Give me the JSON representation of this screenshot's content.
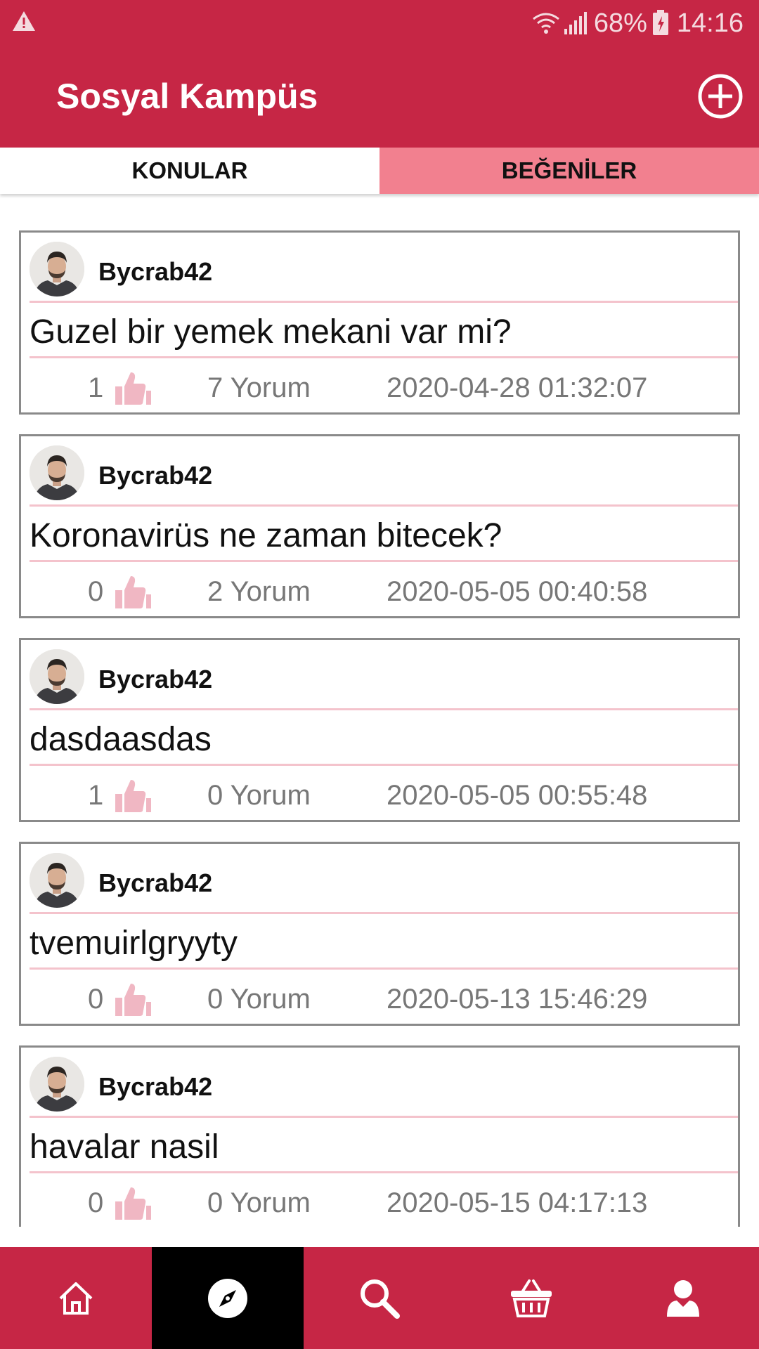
{
  "status_bar": {
    "battery": "68%",
    "time": "14:16"
  },
  "app": {
    "title": "Sosyal Kampüs"
  },
  "tabs": [
    {
      "label": "KONULAR"
    },
    {
      "label": "BEĞENİLER"
    }
  ],
  "posts": [
    {
      "username": "Bycrab42",
      "title": "Guzel bir yemek mekani var mi?",
      "likes": "1",
      "comments": "7 Yorum",
      "date": "2020-04-28 01:32:07"
    },
    {
      "username": "Bycrab42",
      "title": "Koronavirüs ne zaman bitecek?",
      "likes": "0",
      "comments": "2 Yorum",
      "date": "2020-05-05 00:40:58"
    },
    {
      "username": "Bycrab42",
      "title": "dasdaasdas",
      "likes": "1",
      "comments": "0 Yorum",
      "date": "2020-05-05 00:55:48"
    },
    {
      "username": "Bycrab42",
      "title": "tvemuirlgryyty",
      "likes": "0",
      "comments": "0 Yorum",
      "date": "2020-05-13 15:46:29"
    },
    {
      "username": "Bycrab42",
      "title": "havalar nasil",
      "likes": "0",
      "comments": "0 Yorum",
      "date": "2020-05-15 04:17:13"
    }
  ],
  "bottom_nav": [
    {
      "icon": "home-icon",
      "active": false
    },
    {
      "icon": "compass-icon",
      "active": true
    },
    {
      "icon": "search-icon",
      "active": false
    },
    {
      "icon": "basket-icon",
      "active": false
    },
    {
      "icon": "profile-icon",
      "active": false
    }
  ],
  "colors": {
    "primary": "#c62645",
    "tab_active": "#f2808f",
    "divider": "#f4c3cc",
    "like": "#f0b7c3"
  }
}
